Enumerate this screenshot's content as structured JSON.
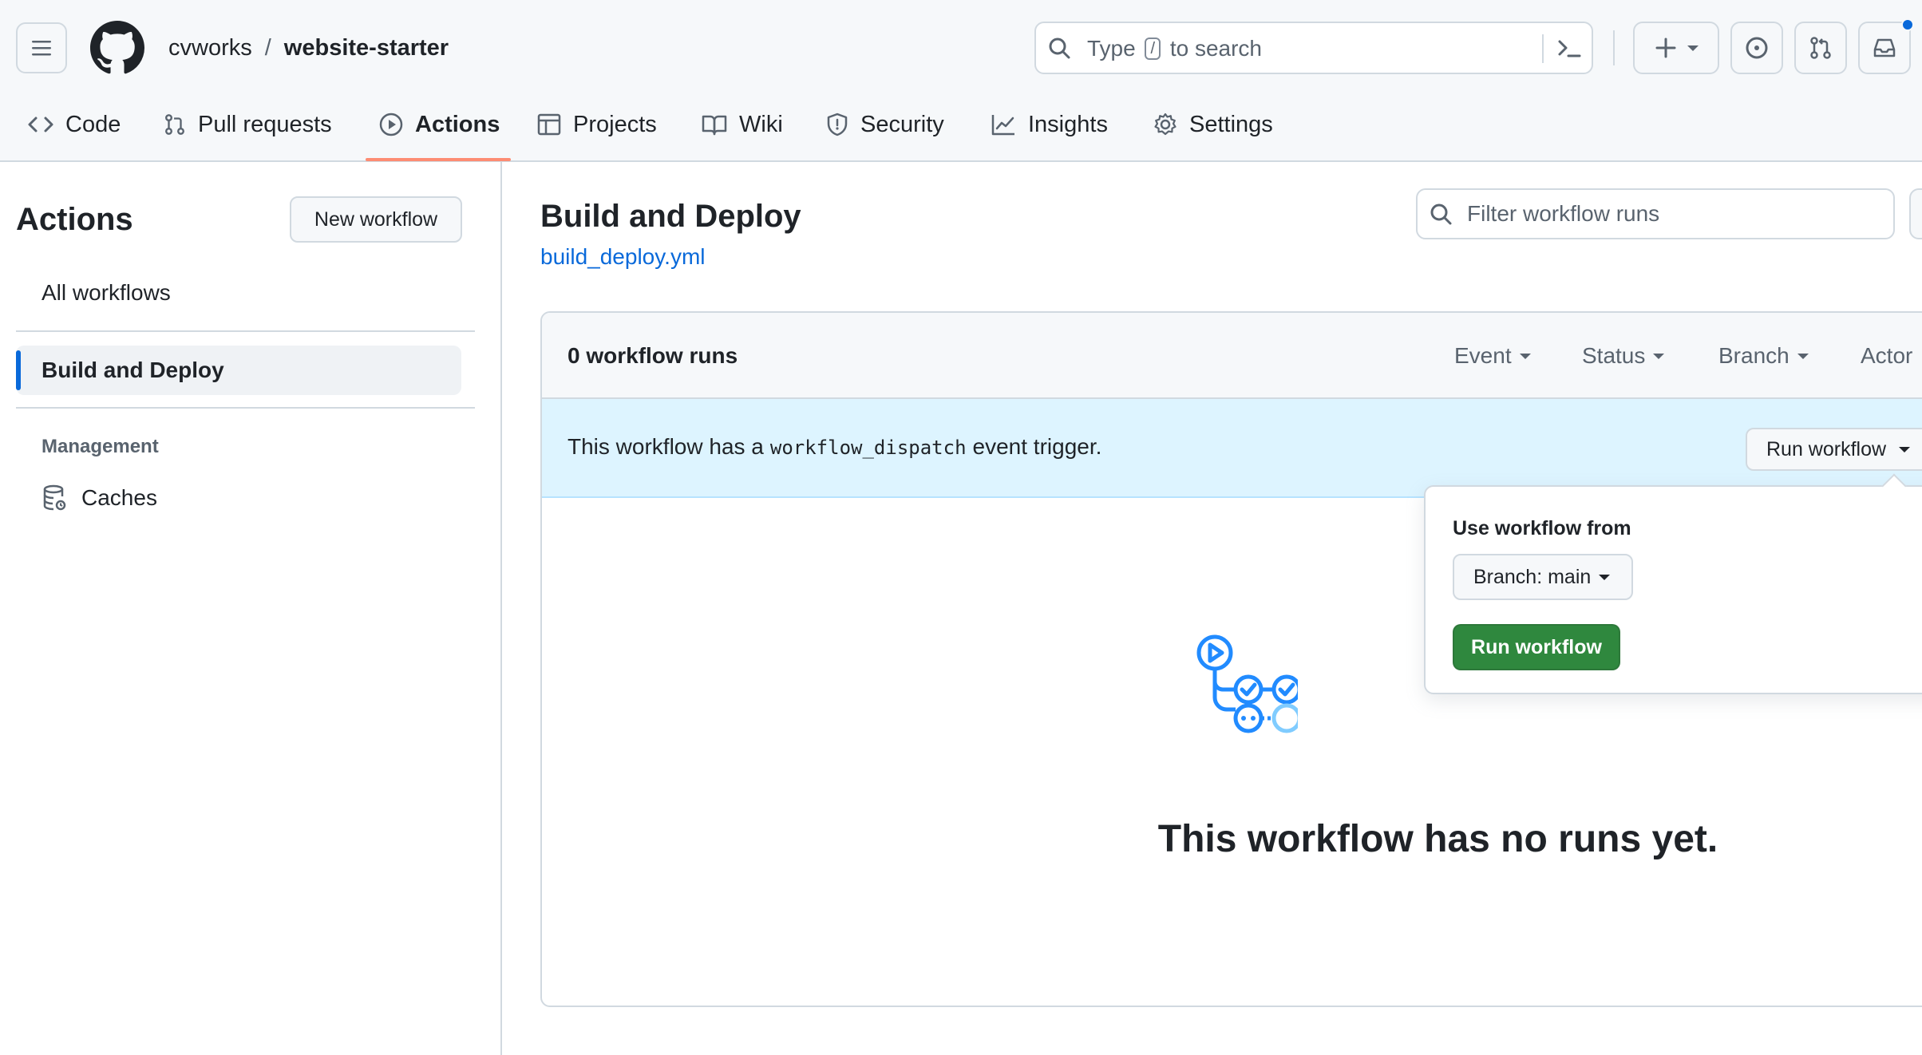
{
  "header": {
    "owner": "cvworks",
    "separator": "/",
    "repo": "website-starter",
    "search": {
      "prefix": "Type",
      "kbd": "/",
      "suffix": "to search"
    }
  },
  "tabs": [
    {
      "label": "Code",
      "icon": "code-icon"
    },
    {
      "label": "Pull requests",
      "icon": "pull-request-icon"
    },
    {
      "label": "Actions",
      "icon": "play-icon",
      "active": true
    },
    {
      "label": "Projects",
      "icon": "table-icon"
    },
    {
      "label": "Wiki",
      "icon": "book-icon"
    },
    {
      "label": "Security",
      "icon": "shield-icon"
    },
    {
      "label": "Insights",
      "icon": "graph-icon"
    },
    {
      "label": "Settings",
      "icon": "gear-icon"
    }
  ],
  "sidebar": {
    "title": "Actions",
    "new_workflow": "New workflow",
    "all_workflows": "All workflows",
    "selected_workflow": "Build and Deploy",
    "management_heading": "Management",
    "caches": "Caches"
  },
  "main": {
    "title": "Build and Deploy",
    "file": "build_deploy.yml",
    "filter_placeholder": "Filter workflow runs",
    "runs_count": "0 workflow runs",
    "filters": [
      "Event",
      "Status",
      "Branch",
      "Actor"
    ],
    "dispatch": {
      "prefix": "This workflow has a",
      "code": "workflow_dispatch",
      "suffix": "event trigger."
    },
    "run_workflow_dropdown": "Run workflow",
    "empty_title": "This workflow has no runs yet."
  },
  "popover": {
    "label": "Use workflow from",
    "branch": "Branch: main",
    "run_button": "Run workflow"
  },
  "colors": {
    "accent_blue": "#0969da",
    "active_tab_underline": "#fd8c73",
    "run_button_green": "#2f883e",
    "banner_blue": "#ddf4ff"
  }
}
